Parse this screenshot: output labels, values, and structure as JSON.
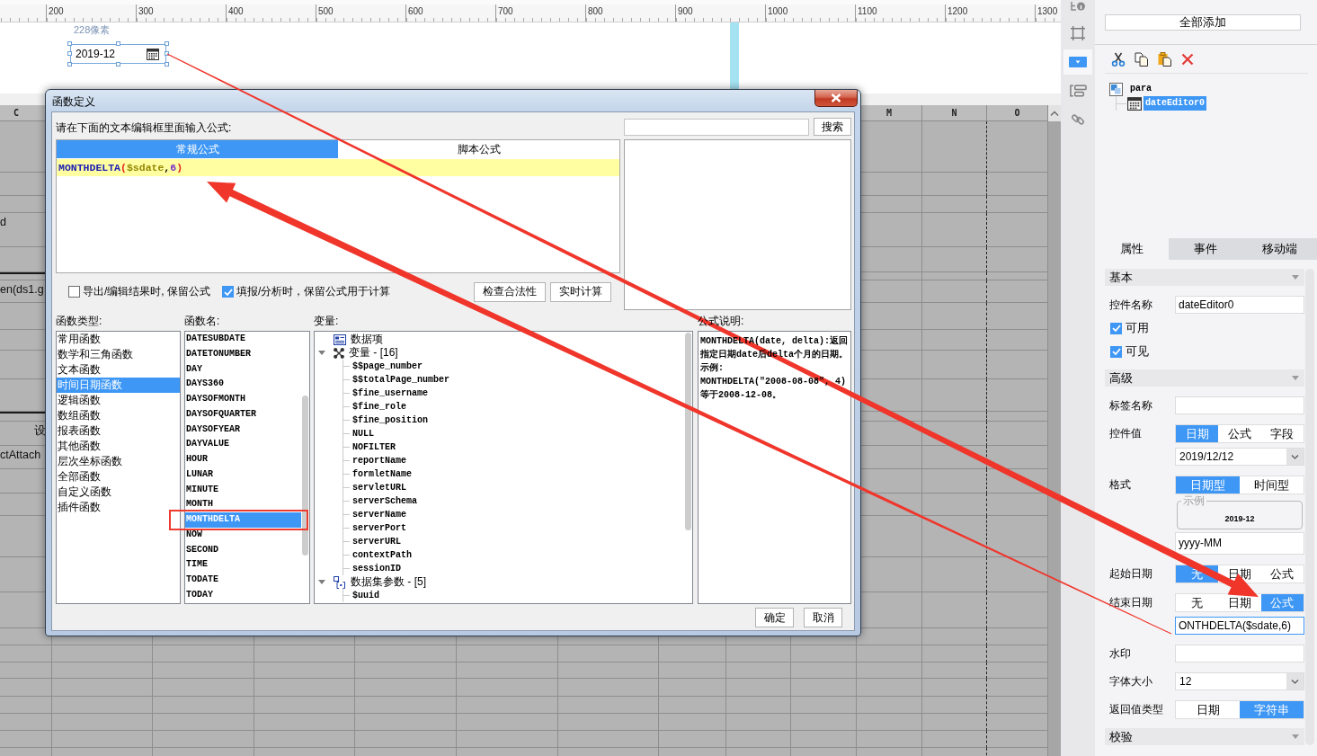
{
  "ruler": {
    "labels": [
      "200",
      "300",
      "400",
      "500",
      "600",
      "700",
      "800",
      "900",
      "1000",
      "1100",
      "1200",
      "1300"
    ]
  },
  "canvas": {
    "size_label": "228像素",
    "date_editor": {
      "value": "2019-12",
      "selected": true
    }
  },
  "sheet": {
    "column_headers": [
      "C",
      "M",
      "N",
      "O"
    ],
    "cell_texts": [
      "d",
      "en(ds1.g",
      "设",
      "ctAttach"
    ]
  },
  "dialog": {
    "title": "函数定义",
    "prompt": "请在下面的文本编辑框里面输入公式:",
    "search_button": "搜索",
    "tabs": [
      {
        "label": "常规公式",
        "selected": true
      },
      {
        "label": "脚本公式",
        "selected": false
      }
    ],
    "formula": [
      {
        "text": "MONTHDELTA",
        "kind": "function"
      },
      {
        "text": "(",
        "kind": "paren"
      },
      {
        "text": "$sdate",
        "kind": "variable"
      },
      {
        "text": ",",
        "kind": "separator"
      },
      {
        "text": "6",
        "kind": "number"
      },
      {
        "text": ")",
        "kind": "paren"
      }
    ],
    "options": [
      {
        "label": "导出/编辑结果时, 保留公式",
        "checked": false
      },
      {
        "label": "填报/分析时，保留公式用于计算",
        "checked": true
      }
    ],
    "action_buttons": [
      "检查合法性",
      "实时计算"
    ],
    "function_types": {
      "label": "函数类型:",
      "items": [
        {
          "label": "常用函数",
          "selected": false
        },
        {
          "label": "数学和三角函数",
          "selected": false
        },
        {
          "label": "文本函数",
          "selected": false
        },
        {
          "label": "时间日期函数",
          "selected": true
        },
        {
          "label": "逻辑函数",
          "selected": false
        },
        {
          "label": "数组函数",
          "selected": false
        },
        {
          "label": "报表函数",
          "selected": false
        },
        {
          "label": "其他函数",
          "selected": false
        },
        {
          "label": "层次坐标函数",
          "selected": false
        },
        {
          "label": "全部函数",
          "selected": false
        },
        {
          "label": "自定义函数",
          "selected": false
        },
        {
          "label": "插件函数",
          "selected": false
        }
      ]
    },
    "function_names": {
      "label": "函数名:",
      "items": [
        {
          "label": "DATESUBDATE",
          "selected": false,
          "annotated": false
        },
        {
          "label": "DATETONUMBER",
          "selected": false,
          "annotated": false
        },
        {
          "label": "DAY",
          "selected": false,
          "annotated": false
        },
        {
          "label": "DAYS360",
          "selected": false,
          "annotated": false
        },
        {
          "label": "DAYSOFMONTH",
          "selected": false,
          "annotated": false
        },
        {
          "label": "DAYSOFQUARTER",
          "selected": false,
          "annotated": false
        },
        {
          "label": "DAYSOFYEAR",
          "selected": false,
          "annotated": false
        },
        {
          "label": "DAYVALUE",
          "selected": false,
          "annotated": false
        },
        {
          "label": "HOUR",
          "selected": false,
          "annotated": false
        },
        {
          "label": "LUNAR",
          "selected": false,
          "annotated": false
        },
        {
          "label": "MINUTE",
          "selected": false,
          "annotated": false
        },
        {
          "label": "MONTH",
          "selected": false,
          "annotated": false
        },
        {
          "label": "MONTHDELTA",
          "selected": true,
          "annotated": true
        },
        {
          "label": "NOW",
          "selected": false,
          "annotated": false
        },
        {
          "label": "SECOND",
          "selected": false,
          "annotated": false
        },
        {
          "label": "TIME",
          "selected": false,
          "annotated": false
        },
        {
          "label": "TODATE",
          "selected": false,
          "annotated": false
        },
        {
          "label": "TODAY",
          "selected": false,
          "annotated": false
        }
      ]
    },
    "variables": {
      "label": "变量:",
      "tree": [
        {
          "label": "数据项",
          "kind": "data_items"
        },
        {
          "label": "变量 - [16]",
          "kind": "variables",
          "expanded": true,
          "children": [
            "$$page_number",
            "$$totalPage_number",
            "$fine_username",
            "$fine_role",
            "$fine_position",
            "NULL",
            "NOFILTER",
            "reportName",
            "formletName",
            "servletURL",
            "serverSchema",
            "serverName",
            "serverPort",
            "serverURL",
            "contextPath",
            "sessionID"
          ]
        },
        {
          "label": "数据集参数 - [5]",
          "kind": "parameters",
          "expanded": true,
          "children": [
            "$uuid"
          ]
        }
      ]
    },
    "description": {
      "label": "公式说明:",
      "paragraphs": [
        "MONTHDELTA(date, delta):返回指定日期date后delta个月的日期。",
        "示例:",
        "MONTHDELTA(\"2008-08-08\", 4)",
        "等于2008-12-08。"
      ]
    },
    "buttons": [
      "确定",
      "取消"
    ]
  },
  "side_panel": {
    "nav_icons": [
      {
        "selected": false
      },
      {
        "selected": false
      },
      {
        "selected": true
      },
      {
        "selected": false
      },
      {
        "selected": false
      }
    ],
    "add_all_button": "全部添加",
    "tree": [
      {
        "label": "para",
        "selected": false,
        "children": [
          {
            "label": "dateEditor0",
            "selected": true
          }
        ]
      }
    ],
    "tabs": [
      {
        "label": "属性",
        "selected": true
      },
      {
        "label": "事件",
        "selected": false
      },
      {
        "label": "移动端",
        "selected": false
      }
    ],
    "properties": [
      {
        "kind": "section",
        "label": "基本"
      },
      {
        "kind": "text",
        "label": "控件名称",
        "value": "dateEditor0",
        "focused": false
      },
      {
        "kind": "checkbox",
        "label": "可用",
        "checked": true
      },
      {
        "kind": "checkbox",
        "label": "可见",
        "checked": true
      },
      {
        "kind": "section",
        "label": "高级"
      },
      {
        "kind": "text",
        "label": "标签名称",
        "focused": false
      },
      {
        "kind": "segmented",
        "label": "控件值",
        "options": [
          {
            "label": "日期",
            "selected": true
          },
          {
            "label": "公式",
            "selected": false
          },
          {
            "label": "字段",
            "selected": false
          }
        ]
      },
      {
        "kind": "select",
        "value": "2019/12/12"
      },
      {
        "kind": "segmented",
        "label": "格式",
        "options": [
          {
            "label": "日期型",
            "selected": true
          },
          {
            "label": "时间型",
            "selected": false
          }
        ]
      },
      {
        "kind": "example",
        "label": "示例",
        "value": "2019-12"
      },
      {
        "kind": "text",
        "value": "yyyy-MM",
        "focused": false
      },
      {
        "kind": "segmented",
        "label": "起始日期",
        "options": [
          {
            "label": "无",
            "selected": true
          },
          {
            "label": "日期",
            "selected": false
          },
          {
            "label": "公式",
            "selected": false
          }
        ]
      },
      {
        "kind": "segmented",
        "label": "结束日期",
        "options": [
          {
            "label": "无",
            "selected": false
          },
          {
            "label": "日期",
            "selected": false
          },
          {
            "label": "公式",
            "selected": true
          }
        ]
      },
      {
        "kind": "text",
        "value": "ONTHDELTA($sdate,6)",
        "focused": true
      },
      {
        "kind": "text",
        "label": "水印",
        "focused": false
      },
      {
        "kind": "select",
        "label": "字体大小",
        "value": "12"
      },
      {
        "kind": "segmented",
        "label": "返回值类型",
        "options": [
          {
            "label": "日期",
            "selected": false
          },
          {
            "label": "字符串",
            "selected": true
          }
        ]
      },
      {
        "kind": "section",
        "label": "校验"
      }
    ]
  }
}
